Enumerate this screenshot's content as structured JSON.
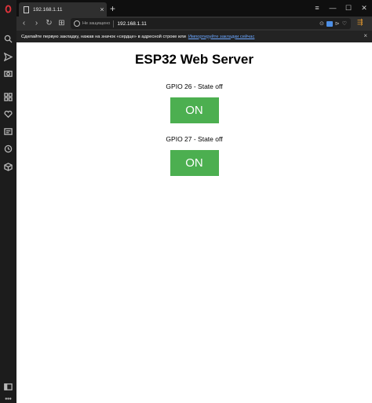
{
  "browser": {
    "tab": {
      "title": "192.168.1.11",
      "close_glyph": "×"
    },
    "new_tab_glyph": "+",
    "window_controls": {
      "menu": "≡",
      "minimize": "—",
      "maximize": "☐",
      "close": "✕"
    },
    "nav": {
      "back": "‹",
      "forward": "›",
      "reload": "↻",
      "tabs_overview": "⊞"
    },
    "address": {
      "security_text": "Не защищено",
      "url": "192.168.1.11"
    },
    "menu_glyph": "⇶"
  },
  "bookmarks_hint": {
    "text": "Сделайте первую закладку, нажав на значок «сердце» в адресной строке или",
    "link": "Импортируйте закладки сейчас",
    "close": "×"
  },
  "sidebar": {
    "icons": [
      "opera-logo-icon",
      "search-icon",
      "send-icon",
      "camera-icon",
      "grid-icon",
      "heart-icon",
      "news-icon",
      "history-icon",
      "cube-icon",
      "sidebar-toggle-icon",
      "more-icon"
    ]
  },
  "page": {
    "title": "ESP32 Web Server",
    "gpios": [
      {
        "label": "GPIO 26 - State off",
        "button": "ON"
      },
      {
        "label": "GPIO 27 - State off",
        "button": "ON"
      }
    ],
    "button_color": "#4caf50"
  }
}
